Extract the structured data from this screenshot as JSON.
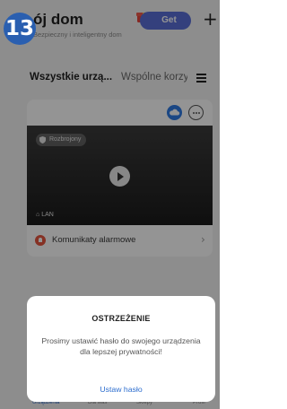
{
  "header": {
    "step_number": "13",
    "home_title": "ój dom",
    "home_subtitle": "Bezpieczny i inteligentny dom",
    "get_button_label": "Get",
    "add_icon": "plus-icon"
  },
  "tabs": {
    "active_label": "Wszystkie urzą...",
    "other_label": "Wspólne korzy",
    "menu_icon": "menu-icon"
  },
  "device_card": {
    "status_badge": "Rozbrojony",
    "network_label": "LAN",
    "alarm_row_label": "Komunikaty alarmowe"
  },
  "bottom_nav": {
    "items": [
      "Urządzenia",
      "Dla was",
      "Sklepy",
      "Profil"
    ]
  },
  "dialog": {
    "title": "OSTRZEŻENIE",
    "message": "Prosimy ustawić hasło do swojego urządzenia dla lepszej prywatności!",
    "action_label": "Ustaw hasło"
  },
  "colors": {
    "accent_blue": "#2f6fcf",
    "step_badge": "#2a5fb0",
    "alarm_red": "#e5553f"
  }
}
